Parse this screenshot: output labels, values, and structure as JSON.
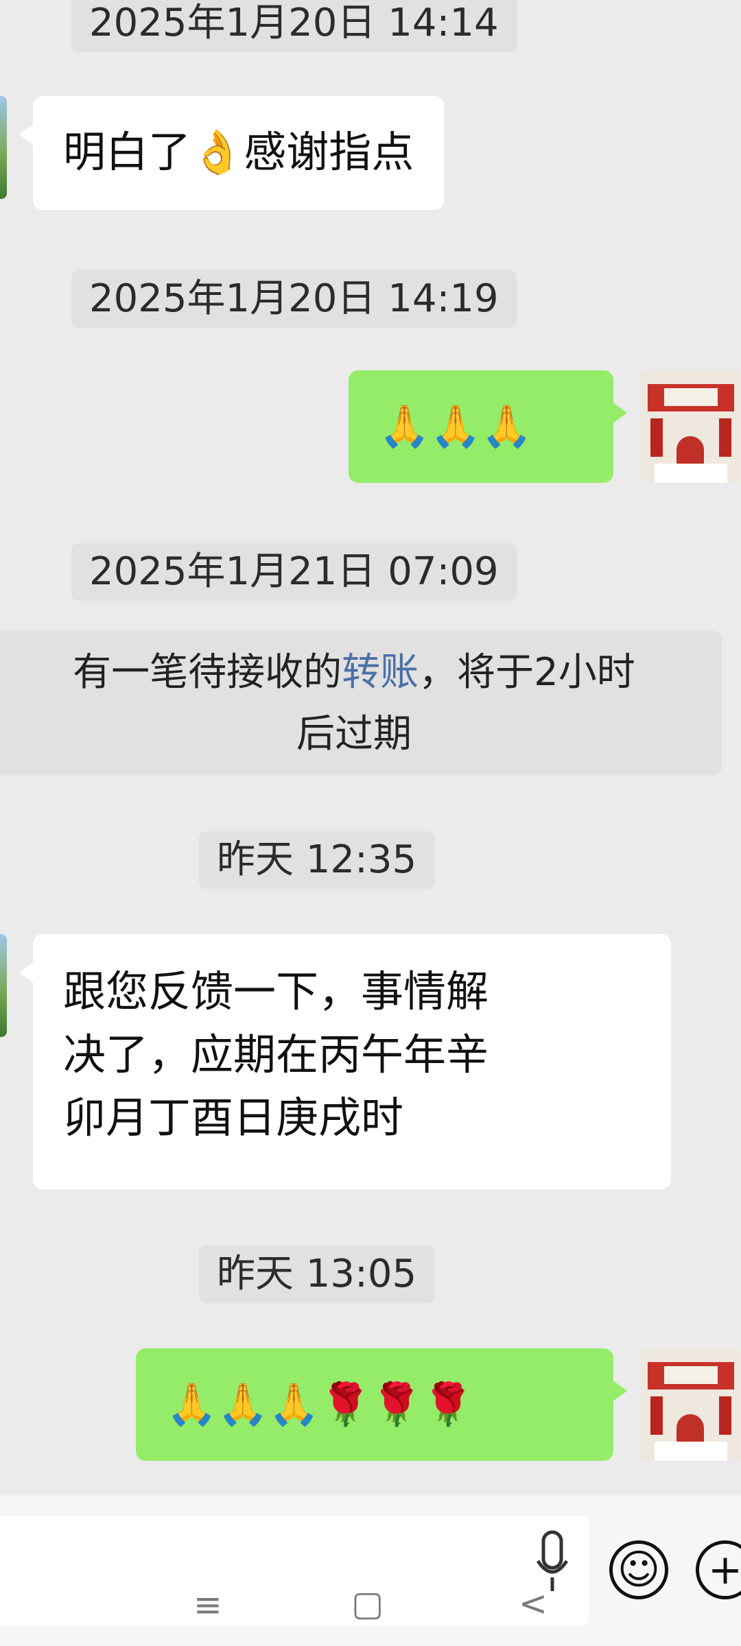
{
  "messages": {
    "ts1": "2025年1月20日 14:14",
    "in1": "明白了👌感谢指点",
    "ts2": "2025年1月20日 14:19",
    "out1": "🙏🙏🙏",
    "ts3": "2025年1月21日 07:09",
    "system_prefix": "有一笔待接收的",
    "system_link": "转账",
    "system_suffix_line1": "，将于2小时",
    "system_suffix_line2": "后过期",
    "ts4": "昨天 12:35",
    "in2_line1": "跟您反馈一下，事情解",
    "in2_line2": "决了，应期在丙午年辛",
    "in2_line3": "卯月丁酉日庚戌时",
    "ts5": "昨天 13:05",
    "out2": "🙏🙏🙏🌹🌹🌹"
  },
  "bottom": {
    "emoji_button": "☺",
    "plus_button": "+",
    "nav_menu": "≡",
    "nav_home": "▢",
    "nav_back": "<"
  },
  "icons": {
    "emoji": "smiley-icon",
    "plus": "plus-icon",
    "mic": "microphone-icon",
    "menu": "menu-icon",
    "home": "home-icon",
    "back": "back-icon"
  },
  "colors": {
    "chat_bg": "#ebebeb",
    "incoming_bubble": "#ffffff",
    "outgoing_bubble": "#95ec69",
    "timestamp_bg": "#e1e1e1",
    "link": "#4a6fa5"
  }
}
